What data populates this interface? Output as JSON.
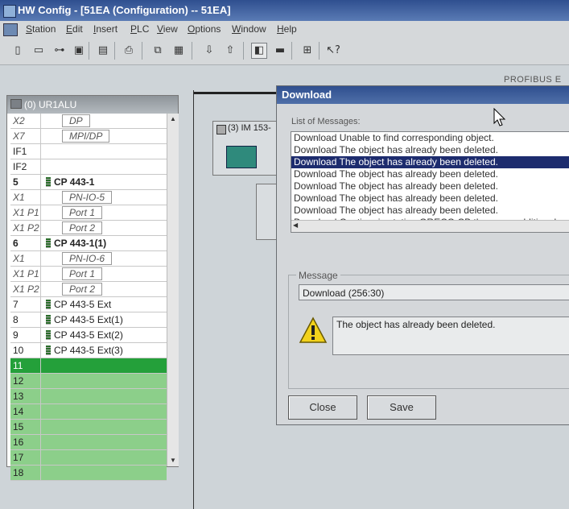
{
  "app": {
    "title": "HW Config - [51EA (Configuration) -- 51EA]"
  },
  "menu": [
    "Station",
    "Edit",
    "Insert",
    "PLC",
    "View",
    "Options",
    "Window",
    "Help"
  ],
  "toolbar": {
    "icons": [
      "new-icon",
      "open-icon",
      "accessible-nodes-icon",
      "save-icon",
      "save-compile-icon",
      "print-icon",
      "copy-icon",
      "paste-icon",
      "download-icon",
      "upload-icon",
      "catalog-icon",
      "overview-icon",
      "network-icon",
      "help-icon"
    ]
  },
  "profibus_label": "PROFIBUS E",
  "rack": {
    "title": "(0) UR1ALU",
    "rows": [
      {
        "slot": "X2",
        "module": "DP",
        "type": "sub"
      },
      {
        "slot": "X7",
        "module": "MPI/DP",
        "type": "sub"
      },
      {
        "slot": "IF1",
        "module": "",
        "type": "plain"
      },
      {
        "slot": "IF2",
        "module": "",
        "type": "plain"
      },
      {
        "slot": "5",
        "module": "CP 443-1",
        "type": "bold"
      },
      {
        "slot": "X1",
        "module": "PN-IO-5",
        "type": "sub"
      },
      {
        "slot": "X1 P1",
        "module": "Port 1",
        "type": "sub"
      },
      {
        "slot": "X1 P2",
        "module": "Port 2",
        "type": "sub"
      },
      {
        "slot": "6",
        "module": "CP 443-1(1)",
        "type": "bold"
      },
      {
        "slot": "X1",
        "module": "PN-IO-6",
        "type": "sub"
      },
      {
        "slot": "X1 P1",
        "module": "Port 1",
        "type": "sub"
      },
      {
        "slot": "X1 P2",
        "module": "Port 2",
        "type": "sub"
      },
      {
        "slot": "7",
        "module": "CP 443-5 Ext",
        "type": "module"
      },
      {
        "slot": "8",
        "module": "CP 443-5 Ext(1)",
        "type": "module"
      },
      {
        "slot": "9",
        "module": "CP 443-5 Ext(2)",
        "type": "module"
      },
      {
        "slot": "10",
        "module": "CP 443-5 Ext(3)",
        "type": "module"
      },
      {
        "slot": "11",
        "module": "",
        "type": "green-sel"
      },
      {
        "slot": "12",
        "module": "",
        "type": "green"
      },
      {
        "slot": "13",
        "module": "",
        "type": "green"
      },
      {
        "slot": "14",
        "module": "",
        "type": "green"
      },
      {
        "slot": "15",
        "module": "",
        "type": "green"
      },
      {
        "slot": "16",
        "module": "",
        "type": "green"
      },
      {
        "slot": "17",
        "module": "",
        "type": "green"
      },
      {
        "slot": "18",
        "module": "",
        "type": "green"
      }
    ]
  },
  "im153": {
    "label": "(3) IM 153-"
  },
  "dialog": {
    "title": "Download",
    "list_label": "List of Messages:",
    "messages": [
      "Download  Unable to find corresponding object.",
      "Download  The object has already been deleted.",
      "Download  The object has already been deleted.",
      "Download  The object has already been deleted.",
      "Download  The object has already been deleted.",
      "Download  The object has already been deleted.",
      "Download  The object has already been deleted.",
      "Download  Caution: in station GRECO CB there are additional"
    ],
    "selected_index": 2,
    "group_label": "Message",
    "message_id": "Download (256:30)",
    "message_text": "The object has already been deleted.",
    "close_label": "Close",
    "save_label": "Save"
  }
}
